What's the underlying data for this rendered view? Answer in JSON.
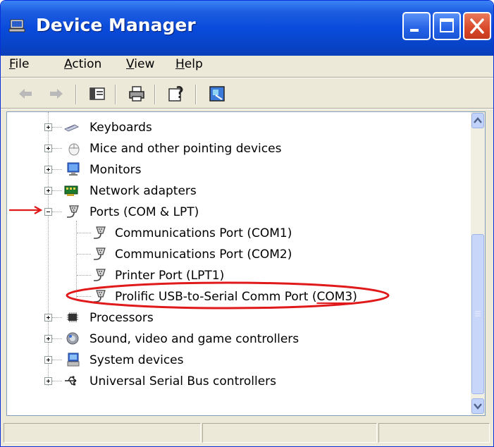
{
  "window": {
    "title": "Device Manager",
    "title_icon": "computer-icon"
  },
  "menu": [
    {
      "label": "File",
      "mnemonic": "F",
      "rest": "ile"
    },
    {
      "label": "Action",
      "mnemonic": "A",
      "rest": "ction"
    },
    {
      "label": "View",
      "mnemonic": "V",
      "rest": "iew"
    },
    {
      "label": "Help",
      "mnemonic": "H",
      "rest": "elp"
    }
  ],
  "toolbar": [
    "back-arrow-icon",
    "forward-arrow-icon",
    "show-hide-tree-icon",
    "print-icon",
    "properties-icon",
    "update-driver-icon"
  ],
  "tree": {
    "categories": [
      {
        "label": "Keyboards",
        "icon": "keyboard-icon",
        "expanded": false
      },
      {
        "label": "Mice and other pointing devices",
        "icon": "mouse-icon",
        "expanded": false
      },
      {
        "label": "Monitors",
        "icon": "monitor-icon",
        "expanded": false
      },
      {
        "label": "Network adapters",
        "icon": "network-adapter-icon",
        "expanded": false
      },
      {
        "label": "Ports (COM & LPT)",
        "icon": "port-connector-icon",
        "expanded": true
      },
      {
        "label": "Processors",
        "icon": "processor-icon",
        "expanded": false
      },
      {
        "label": "Sound, video and game controllers",
        "icon": "speaker-icon",
        "expanded": false
      },
      {
        "label": "System devices",
        "icon": "system-device-icon",
        "expanded": false
      },
      {
        "label": "Universal Serial Bus controllers",
        "icon": "usb-icon",
        "expanded": false
      }
    ],
    "ports_children": [
      {
        "label": "Communications Port (COM1)"
      },
      {
        "label": "Communications Port (COM2)"
      },
      {
        "label": "Printer Port (LPT1)"
      },
      {
        "label_prefix": "Prolific USB-to-Serial Comm Port (",
        "label_port": "COM3",
        "label_suffix": ")"
      }
    ]
  },
  "colors": {
    "titlebar": "#0A4BDC",
    "annotation": "#E0191B",
    "panel": "#ECE9D8"
  }
}
